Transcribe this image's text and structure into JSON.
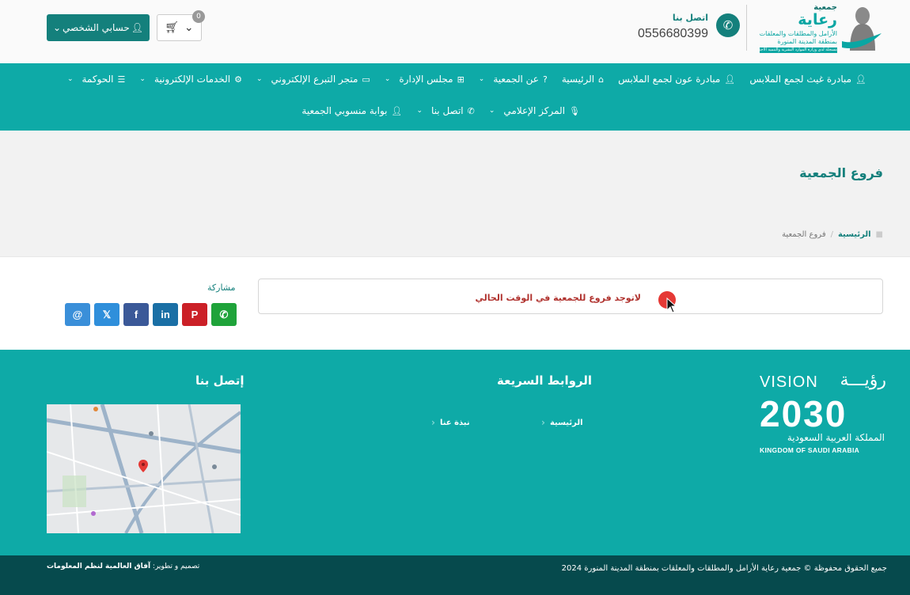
{
  "header": {
    "org": {
      "small": "جمعية",
      "big": "رعاية",
      "sub": "الأرامل والمطلقات والمعلقات بمنطقة المدينة المنورة",
      "strip": "مسجلة لدى وزارة الموارد البشرية والتنمية الاجتماعية"
    },
    "contact_label": "اتصل بنا",
    "phone": "0556680399",
    "account_label": "حسابي الشخصي",
    "cart_count": "0"
  },
  "nav": {
    "row1": [
      {
        "label": "مبادرة غيث لجمع الملابس",
        "icon": "user-icon",
        "dropdown": false
      },
      {
        "label": "مبادرة عون لجمع الملابس",
        "icon": "user-icon",
        "dropdown": false
      },
      {
        "label": "الرئيسية",
        "icon": "home-icon",
        "dropdown": false
      },
      {
        "label": "عن الجمعية",
        "icon": "question-icon",
        "dropdown": true
      },
      {
        "label": "مجلس الإدارة",
        "icon": "sitemap-icon",
        "dropdown": true
      },
      {
        "label": "متجر التبرع الإلكتروني",
        "icon": "card-icon",
        "dropdown": true
      },
      {
        "label": "الخدمات الإلكترونية",
        "icon": "gears-icon",
        "dropdown": true
      },
      {
        "label": "الحوكمة",
        "icon": "list-icon",
        "dropdown": true
      }
    ],
    "row2": [
      {
        "label": "المركز الإعلامي",
        "icon": "mic-icon",
        "dropdown": true
      },
      {
        "label": "اتصل بنا",
        "icon": "phone-icon",
        "dropdown": true
      },
      {
        "label": "بوابة منسوبي الجمعية",
        "icon": "user-icon",
        "dropdown": false
      }
    ]
  },
  "page": {
    "title": "فروع الجمعية",
    "breadcrumb_home": "الرئيسية",
    "breadcrumb_current": "فروع الجمعية"
  },
  "main": {
    "empty_message": "لاتوجد فروع للجمعية في الوقت الحالي",
    "share_label": "مشاركة",
    "share_buttons": [
      {
        "name": "email-share-button",
        "icon": "at-icon",
        "glyph": "@",
        "color": "#3a8fd9"
      },
      {
        "name": "x-share-button",
        "icon": "x-icon",
        "glyph": "𝕏",
        "color": "#2f8fdb"
      },
      {
        "name": "facebook-share-button",
        "icon": "facebook-icon",
        "glyph": "f",
        "color": "#3b5998"
      },
      {
        "name": "linkedin-share-button",
        "icon": "linkedin-icon",
        "glyph": "in",
        "color": "#1a6fa5"
      },
      {
        "name": "pinterest-share-button",
        "icon": "pinterest-icon",
        "glyph": "P",
        "color": "#cb2027"
      },
      {
        "name": "whatsapp-share-button",
        "icon": "whatsapp-icon",
        "glyph": "✆",
        "color": "#1fa33a"
      }
    ]
  },
  "footer": {
    "vision": {
      "en": "VISION",
      "ar": "رؤيـــة",
      "year": "2030",
      "ksa_ar": "المملكة العربية السعودية",
      "ksa_en": "KINGDOM OF SAUDI ARABIA"
    },
    "quick_links_title": "الروابط السريعة",
    "quick_links": [
      "الرئيسية",
      "نبذة عنا"
    ],
    "contact_title": "إتصل بنا",
    "copyright": "جميع الحقوق محفوظة © جمعية رعاية الأرامل والمطلقات والمعلقات بمنطقة المدينة المنورة 2024",
    "design_prefix": "تصميم و تطوير:",
    "design_company": "آفاق العالمية لنظم المعلومات"
  },
  "colors": {
    "brand": "#0eaaa7",
    "brand_dark": "#14807c",
    "footer_bottom": "#064a4d",
    "alert_text": "#b0322e"
  }
}
